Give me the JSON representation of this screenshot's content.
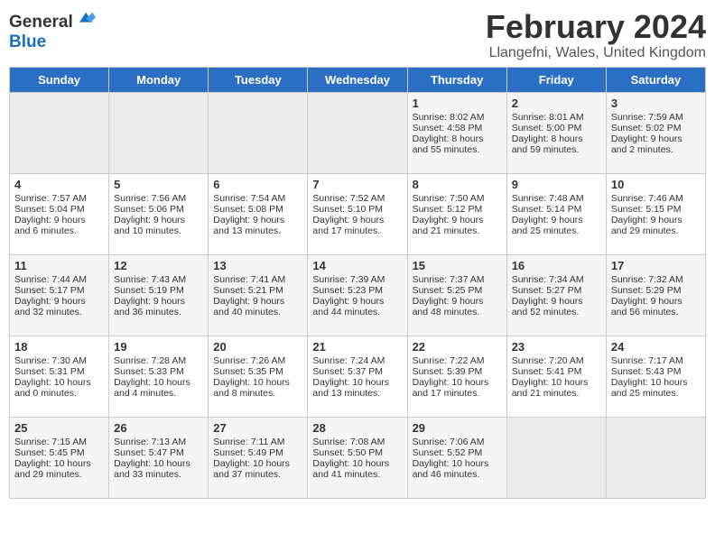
{
  "logo": {
    "line1": "General",
    "line2": "Blue"
  },
  "title": "February 2024",
  "subtitle": "Llangefni, Wales, United Kingdom",
  "days": [
    "Sunday",
    "Monday",
    "Tuesday",
    "Wednesday",
    "Thursday",
    "Friday",
    "Saturday"
  ],
  "weeks": [
    [
      {
        "date": "",
        "info": ""
      },
      {
        "date": "",
        "info": ""
      },
      {
        "date": "",
        "info": ""
      },
      {
        "date": "",
        "info": ""
      },
      {
        "date": "1",
        "info": "Sunrise: 8:02 AM\nSunset: 4:58 PM\nDaylight: 8 hours\nand 55 minutes."
      },
      {
        "date": "2",
        "info": "Sunrise: 8:01 AM\nSunset: 5:00 PM\nDaylight: 8 hours\nand 59 minutes."
      },
      {
        "date": "3",
        "info": "Sunrise: 7:59 AM\nSunset: 5:02 PM\nDaylight: 9 hours\nand 2 minutes."
      }
    ],
    [
      {
        "date": "4",
        "info": "Sunrise: 7:57 AM\nSunset: 5:04 PM\nDaylight: 9 hours\nand 6 minutes."
      },
      {
        "date": "5",
        "info": "Sunrise: 7:56 AM\nSunset: 5:06 PM\nDaylight: 9 hours\nand 10 minutes."
      },
      {
        "date": "6",
        "info": "Sunrise: 7:54 AM\nSunset: 5:08 PM\nDaylight: 9 hours\nand 13 minutes."
      },
      {
        "date": "7",
        "info": "Sunrise: 7:52 AM\nSunset: 5:10 PM\nDaylight: 9 hours\nand 17 minutes."
      },
      {
        "date": "8",
        "info": "Sunrise: 7:50 AM\nSunset: 5:12 PM\nDaylight: 9 hours\nand 21 minutes."
      },
      {
        "date": "9",
        "info": "Sunrise: 7:48 AM\nSunset: 5:14 PM\nDaylight: 9 hours\nand 25 minutes."
      },
      {
        "date": "10",
        "info": "Sunrise: 7:46 AM\nSunset: 5:15 PM\nDaylight: 9 hours\nand 29 minutes."
      }
    ],
    [
      {
        "date": "11",
        "info": "Sunrise: 7:44 AM\nSunset: 5:17 PM\nDaylight: 9 hours\nand 32 minutes."
      },
      {
        "date": "12",
        "info": "Sunrise: 7:43 AM\nSunset: 5:19 PM\nDaylight: 9 hours\nand 36 minutes."
      },
      {
        "date": "13",
        "info": "Sunrise: 7:41 AM\nSunset: 5:21 PM\nDaylight: 9 hours\nand 40 minutes."
      },
      {
        "date": "14",
        "info": "Sunrise: 7:39 AM\nSunset: 5:23 PM\nDaylight: 9 hours\nand 44 minutes."
      },
      {
        "date": "15",
        "info": "Sunrise: 7:37 AM\nSunset: 5:25 PM\nDaylight: 9 hours\nand 48 minutes."
      },
      {
        "date": "16",
        "info": "Sunrise: 7:34 AM\nSunset: 5:27 PM\nDaylight: 9 hours\nand 52 minutes."
      },
      {
        "date": "17",
        "info": "Sunrise: 7:32 AM\nSunset: 5:29 PM\nDaylight: 9 hours\nand 56 minutes."
      }
    ],
    [
      {
        "date": "18",
        "info": "Sunrise: 7:30 AM\nSunset: 5:31 PM\nDaylight: 10 hours\nand 0 minutes."
      },
      {
        "date": "19",
        "info": "Sunrise: 7:28 AM\nSunset: 5:33 PM\nDaylight: 10 hours\nand 4 minutes."
      },
      {
        "date": "20",
        "info": "Sunrise: 7:26 AM\nSunset: 5:35 PM\nDaylight: 10 hours\nand 8 minutes."
      },
      {
        "date": "21",
        "info": "Sunrise: 7:24 AM\nSunset: 5:37 PM\nDaylight: 10 hours\nand 13 minutes."
      },
      {
        "date": "22",
        "info": "Sunrise: 7:22 AM\nSunset: 5:39 PM\nDaylight: 10 hours\nand 17 minutes."
      },
      {
        "date": "23",
        "info": "Sunrise: 7:20 AM\nSunset: 5:41 PM\nDaylight: 10 hours\nand 21 minutes."
      },
      {
        "date": "24",
        "info": "Sunrise: 7:17 AM\nSunset: 5:43 PM\nDaylight: 10 hours\nand 25 minutes."
      }
    ],
    [
      {
        "date": "25",
        "info": "Sunrise: 7:15 AM\nSunset: 5:45 PM\nDaylight: 10 hours\nand 29 minutes."
      },
      {
        "date": "26",
        "info": "Sunrise: 7:13 AM\nSunset: 5:47 PM\nDaylight: 10 hours\nand 33 minutes."
      },
      {
        "date": "27",
        "info": "Sunrise: 7:11 AM\nSunset: 5:49 PM\nDaylight: 10 hours\nand 37 minutes."
      },
      {
        "date": "28",
        "info": "Sunrise: 7:08 AM\nSunset: 5:50 PM\nDaylight: 10 hours\nand 41 minutes."
      },
      {
        "date": "29",
        "info": "Sunrise: 7:06 AM\nSunset: 5:52 PM\nDaylight: 10 hours\nand 46 minutes."
      },
      {
        "date": "",
        "info": ""
      },
      {
        "date": "",
        "info": ""
      }
    ]
  ]
}
